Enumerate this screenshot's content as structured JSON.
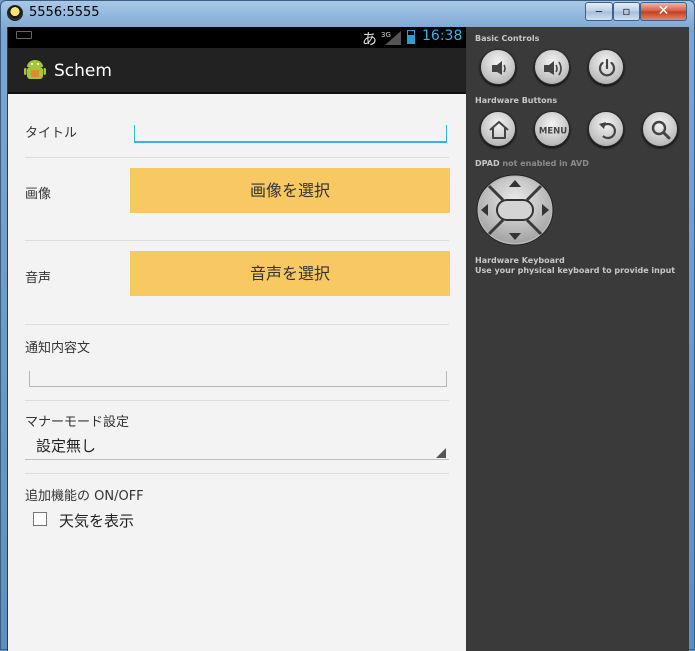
{
  "window": {
    "title": "5556:5555",
    "min": "‒",
    "max": "▫",
    "close": "✕"
  },
  "status": {
    "ime": "あ",
    "network": "3G",
    "time": "16:38"
  },
  "app": {
    "title": "Schem"
  },
  "form": {
    "title_label": "タイトル",
    "title_value": "",
    "image_label": "画像",
    "image_button": "画像を選択",
    "sound_label": "音声",
    "sound_button": "音声を選択",
    "notice_label": "通知内容文",
    "notice_value": "",
    "manner_label": "マナーモード設定",
    "manner_value": "設定無し",
    "extra_label": "追加機能の ON/OFF",
    "weather_checkbox": "天気を表示",
    "weather_checked": false
  },
  "controls": {
    "basic_title": "Basic Controls",
    "hardware_title": "Hardware Buttons",
    "menu_label": "MENU",
    "dpad_title": "DPAD",
    "dpad_note": "not enabled in AVD",
    "keyboard_title": "Hardware Keyboard",
    "keyboard_note": "Use your physical keyboard to provide input",
    "icons": [
      "volume-down-icon",
      "volume-up-icon",
      "power-icon",
      "home-icon",
      "menu-icon",
      "back-icon",
      "search-icon"
    ]
  }
}
